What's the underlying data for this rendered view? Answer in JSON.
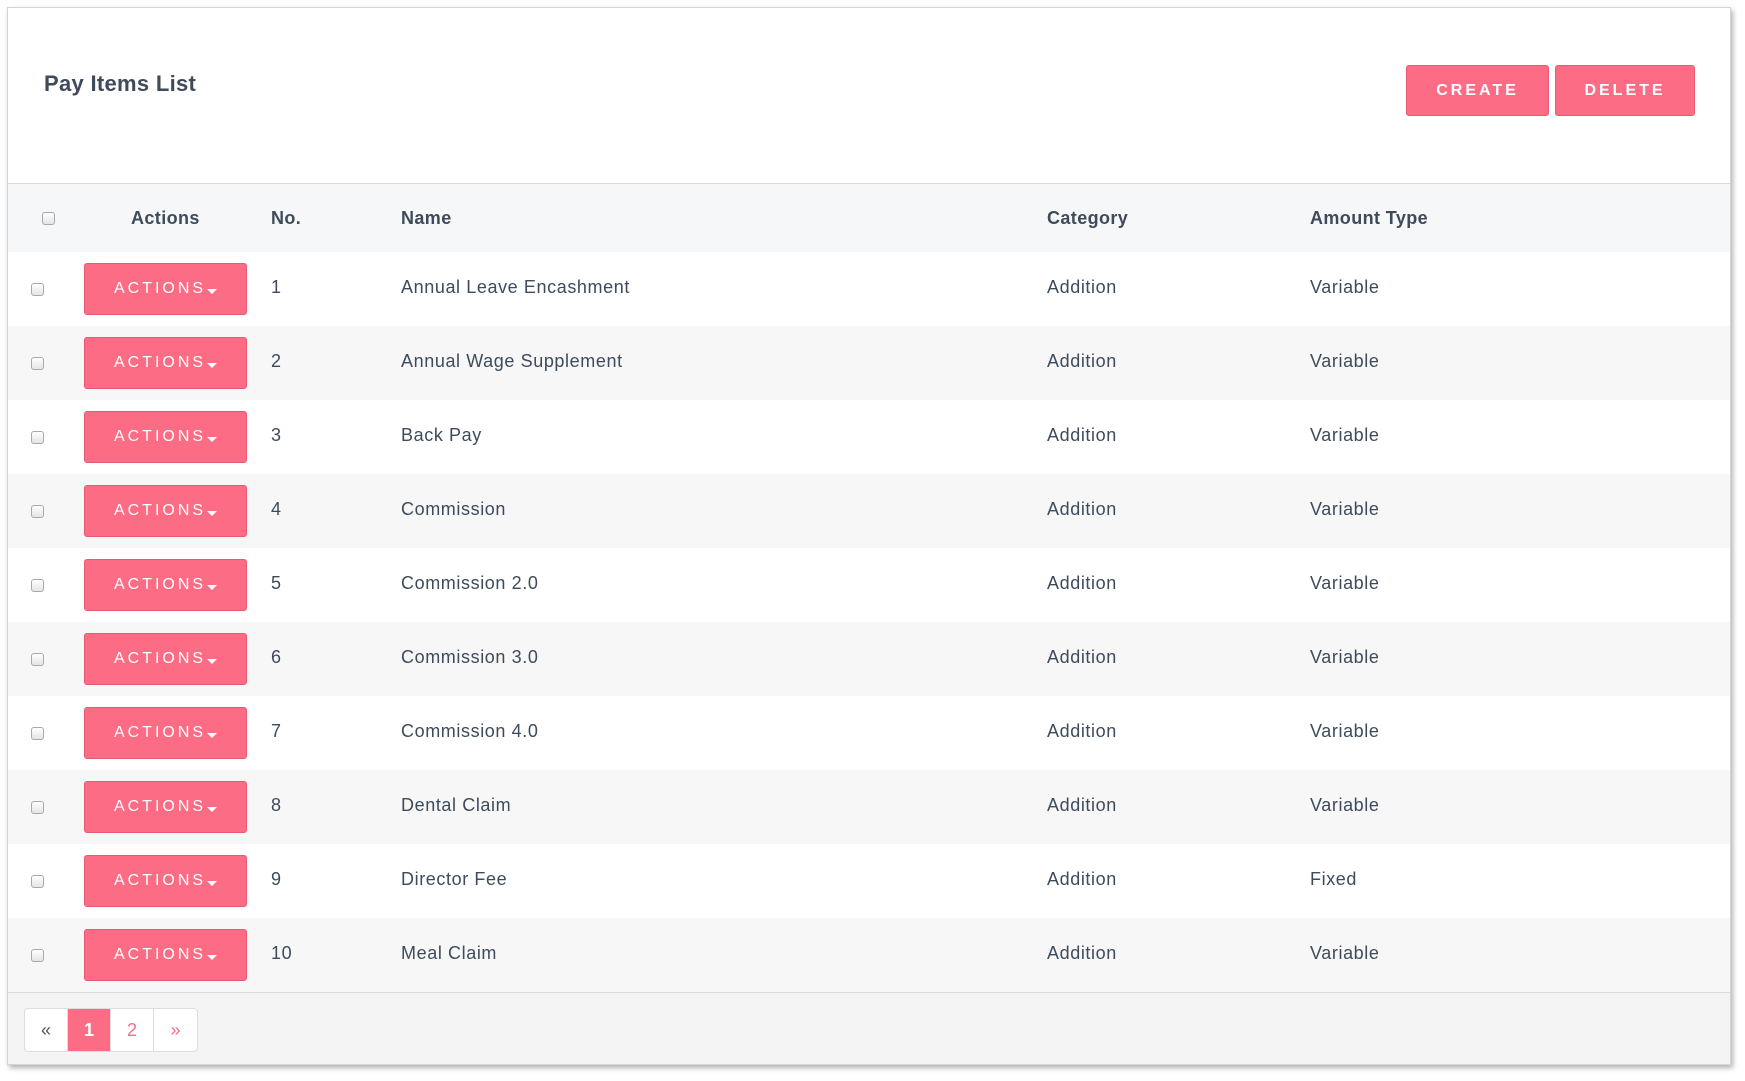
{
  "panel": {
    "title": "Pay Items List",
    "create_label": "CREATE",
    "delete_label": "DELETE"
  },
  "table": {
    "headers": {
      "actions": "Actions",
      "no": "No.",
      "name": "Name",
      "category": "Category",
      "amount_type": "Amount Type"
    },
    "action_label": "ACTIONS",
    "rows": [
      {
        "no": "1",
        "name": "Annual Leave Encashment",
        "category": "Addition",
        "amount_type": "Variable"
      },
      {
        "no": "2",
        "name": "Annual Wage Supplement",
        "category": "Addition",
        "amount_type": "Variable"
      },
      {
        "no": "3",
        "name": "Back Pay",
        "category": "Addition",
        "amount_type": "Variable"
      },
      {
        "no": "4",
        "name": "Commission",
        "category": "Addition",
        "amount_type": "Variable"
      },
      {
        "no": "5",
        "name": "Commission 2.0",
        "category": "Addition",
        "amount_type": "Variable"
      },
      {
        "no": "6",
        "name": "Commission 3.0",
        "category": "Addition",
        "amount_type": "Variable"
      },
      {
        "no": "7",
        "name": "Commission 4.0",
        "category": "Addition",
        "amount_type": "Variable"
      },
      {
        "no": "8",
        "name": "Dental Claim",
        "category": "Addition",
        "amount_type": "Variable"
      },
      {
        "no": "9",
        "name": "Director Fee",
        "category": "Addition",
        "amount_type": "Fixed"
      },
      {
        "no": "10",
        "name": "Meal Claim",
        "category": "Addition",
        "amount_type": "Variable"
      }
    ]
  },
  "pagination": {
    "prev": "«",
    "pages": [
      "1",
      "2"
    ],
    "next": "»",
    "current": "1"
  },
  "colors": {
    "accent": "#fc6c85",
    "text": "#3d4b5c",
    "header_bg": "#f6f7f9"
  }
}
